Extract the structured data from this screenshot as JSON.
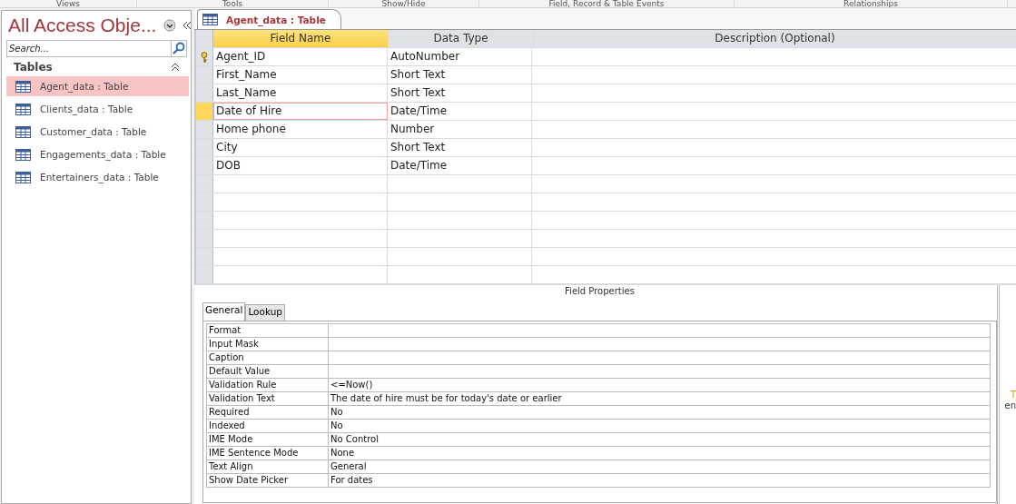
{
  "ribbon_groups": [
    "Views",
    "Tools",
    "Show/Hide",
    "Field, Record & Table Events",
    "Relationships"
  ],
  "nav_pane": {
    "title": "All Access Obje...",
    "search": {
      "placeholder": "Search..."
    },
    "group": {
      "label": "Tables",
      "expanded": true
    },
    "items": [
      {
        "label": "Agent_data : Table",
        "selected": true
      },
      {
        "label": "Clients_data : Table",
        "selected": false
      },
      {
        "label": "Customer_data : Table",
        "selected": false
      },
      {
        "label": "Engagements_data : Table",
        "selected": false
      },
      {
        "label": "Entertainers_data : Table",
        "selected": false
      }
    ]
  },
  "document_tab": {
    "label": "Agent_data : Table",
    "selected": true
  },
  "design_grid": {
    "columns": [
      "Field Name",
      "Data Type",
      "Description (Optional)"
    ],
    "rows": [
      {
        "field": "Agent_ID",
        "type": "AutoNumber",
        "primary_key": true,
        "selected": false
      },
      {
        "field": "First_Name",
        "type": "Short Text",
        "primary_key": false,
        "selected": false
      },
      {
        "field": "Last_Name",
        "type": "Short Text",
        "primary_key": false,
        "selected": false
      },
      {
        "field": "Date of Hire",
        "type": "Date/Time",
        "primary_key": false,
        "selected": true
      },
      {
        "field": "Home phone",
        "type": "Number",
        "primary_key": false,
        "selected": false
      },
      {
        "field": "City",
        "type": "Short Text",
        "primary_key": false,
        "selected": false
      },
      {
        "field": "DOB",
        "type": "Date/Time",
        "primary_key": false,
        "selected": false
      }
    ]
  },
  "field_properties": {
    "title": "Field Properties",
    "tabs": [
      {
        "label": "General",
        "selected": true
      },
      {
        "label": "Lookup",
        "selected": false
      }
    ],
    "properties": [
      {
        "name": "Format"
      },
      {
        "name": "Input Mask"
      },
      {
        "name": "Caption"
      },
      {
        "name": "Default Value"
      },
      {
        "name": "Validation Rule",
        "value": "<=Now()"
      },
      {
        "name": "Validation Text",
        "value": "The date of hire must be for today's date or earlier"
      },
      {
        "name": "Required",
        "value": "No"
      },
      {
        "name": "Indexed",
        "value": "No"
      },
      {
        "name": "IME Mode",
        "value": "No Control"
      },
      {
        "name": "IME Sentence Mode",
        "value": "None"
      },
      {
        "name": "Text Align",
        "value": "General"
      },
      {
        "name": "Show Date Picker",
        "value": "For dates"
      }
    ],
    "help_text": [
      "T",
      "en"
    ]
  }
}
